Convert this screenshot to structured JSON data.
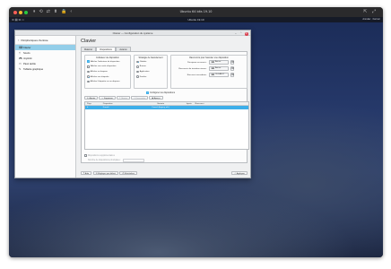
{
  "mac": {
    "window_title": "Ubuntu 64 bits 19.10",
    "toolbar_icons": "⏸ ⟲ ⇄ ⬍ 🔒 ‹",
    "right_icons": "⇱ ⤢"
  },
  "kde_panel": {
    "left_icons": "≡ ▤ ⧉ ▭",
    "center_text": "Ubuntu 19.10",
    "right_text": "Annuler · Fermer"
  },
  "window": {
    "title": "Clavier — Configuration du système",
    "controls": "⌄ ⌃ ✕"
  },
  "sidebar": {
    "header": "Périphériques d'entrée",
    "items": [
      {
        "icon": "⌨",
        "label": "Clavier",
        "active": true
      },
      {
        "icon": "🖱",
        "label": "Souris",
        "active": false
      },
      {
        "icon": "🎮",
        "label": "Joystick",
        "active": false
      },
      {
        "icon": "▭",
        "label": "Pavé tactile",
        "active": false
      },
      {
        "icon": "✎",
        "label": "Tablette graphique",
        "active": false
      }
    ]
  },
  "main": {
    "title": "Clavier",
    "tabs": [
      "Matériel",
      "Dispositions",
      "Avancé"
    ],
    "active_tab": 1
  },
  "indicator_group": {
    "title": "Indicateur de disposition",
    "options": [
      {
        "label": "Afficher l'indicateur de disposition",
        "checked": true,
        "type": "check"
      },
      {
        "label": "Afficher une seule disposition",
        "checked": false,
        "type": "check"
      },
      {
        "label": "Afficher un drapeau",
        "checked": false,
        "type": "radio"
      },
      {
        "label": "Afficher une étiquette",
        "checked": true,
        "type": "radio"
      },
      {
        "label": "Afficher l'étiquette sur un drapeau",
        "checked": false,
        "type": "radio"
      }
    ]
  },
  "switch_policy": {
    "title": "Stratégie de basculement",
    "options": [
      {
        "label": "Globale",
        "checked": true
      },
      {
        "label": "Bureau",
        "checked": false
      },
      {
        "label": "Application",
        "checked": false
      },
      {
        "label": "Fenêtre",
        "checked": false
      }
    ]
  },
  "shortcuts": {
    "title": "Raccourcis pour basculer une disposition",
    "rows": [
      {
        "label": "Principaux raccourcis :",
        "value": "Aucun"
      },
      {
        "label": "Raccourcis de troisième niveau :",
        "value": "Aucun"
      },
      {
        "label": "Raccourci secondaire :",
        "value": "Ctrl+Alt+K"
      }
    ]
  },
  "configure_layouts": {
    "label": "Configurer les dispositions",
    "checked": true
  },
  "toolbar": {
    "add": "Ajouter",
    "remove": "Supprimer",
    "up": "Monter",
    "down": "Descendre",
    "preview": "Aperçu"
  },
  "table": {
    "headers": [
      "Pays",
      "Disposition",
      "Variante",
      "Inputs",
      "Raccourci"
    ],
    "rows": [
      [
        "fr",
        "French",
        "French (legacy, alt.)",
        "",
        ""
      ]
    ]
  },
  "spare_layouts": {
    "checkbox_label": "Dispositions supplémentaires",
    "count_label": "Nombre de dispositions principales :"
  },
  "bottom_bar": {
    "help": "Aide",
    "defaults": "Réglages par défaut",
    "reset": "Réinitialiser",
    "apply": "Appliquer"
  }
}
